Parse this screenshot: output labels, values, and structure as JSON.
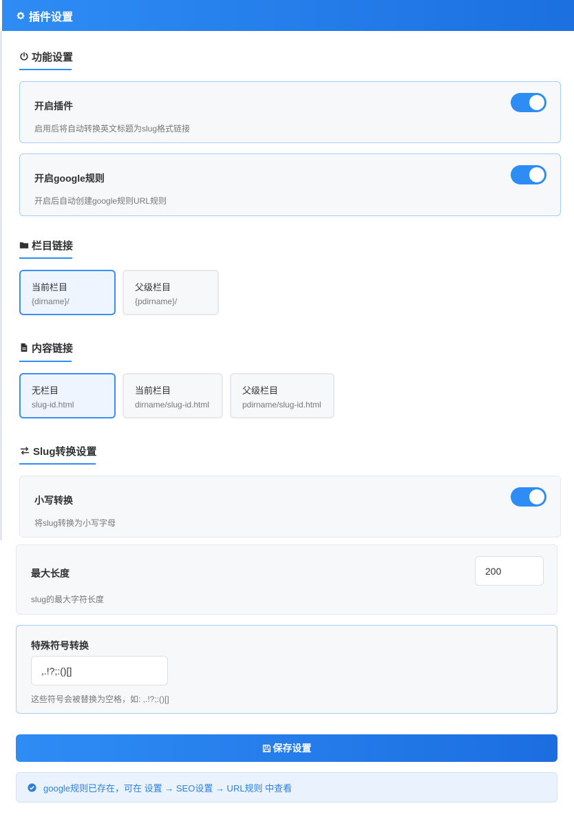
{
  "header": {
    "title": "插件设置",
    "icon": "gear-icon"
  },
  "sections": {
    "function": {
      "title": "功能设置",
      "icon": "power-icon"
    },
    "category": {
      "title": "栏目链接",
      "icon": "folder-icon"
    },
    "content": {
      "title": "内容链接",
      "icon": "file-icon"
    },
    "slug": {
      "title": "Slug转换设置",
      "icon": "exchange-icon"
    }
  },
  "function_settings": {
    "enable_plugin": {
      "title": "开启插件",
      "desc": "启用后将自动转换英文标题为slug格式链接",
      "on": true
    },
    "enable_google": {
      "title": "开启google规则",
      "desc": "开启后自动创建google规则URL规则",
      "on": true
    }
  },
  "category_links": [
    {
      "label": "当前栏目",
      "code": "{dirname}/",
      "selected": true
    },
    {
      "label": "父级栏目",
      "code": "{pdirname}/",
      "selected": false
    }
  ],
  "content_links": [
    {
      "label": "无栏目",
      "code": "slug-id.html",
      "selected": true
    },
    {
      "label": "当前栏目",
      "code": "dirname/slug-id.html",
      "selected": false
    },
    {
      "label": "父级栏目",
      "code": "pdirname/slug-id.html",
      "selected": false
    }
  ],
  "slug_settings": {
    "lowercase": {
      "title": "小写转换",
      "desc": "将slug转换为小写字母",
      "on": true
    },
    "max_length": {
      "title": "最大长度",
      "desc": "slug的最大字符长度",
      "value": "200"
    },
    "special_chars": {
      "title": "特殊符号转换",
      "value": ",.!?;:()[]",
      "desc": "这些符号会被替换为空格，如: ,.!?;:()[]"
    }
  },
  "save_button": {
    "label": "保存设置",
    "icon": "save-icon"
  },
  "notice": {
    "text": "google规则已存在，可在 设置 → SEO设置 → URL规则 中查看",
    "icon": "check-circle-icon"
  },
  "colors": {
    "accent": "#2e8cf5",
    "card_bg": "#f7f8fa",
    "notice_bg": "#eaf3fd"
  }
}
